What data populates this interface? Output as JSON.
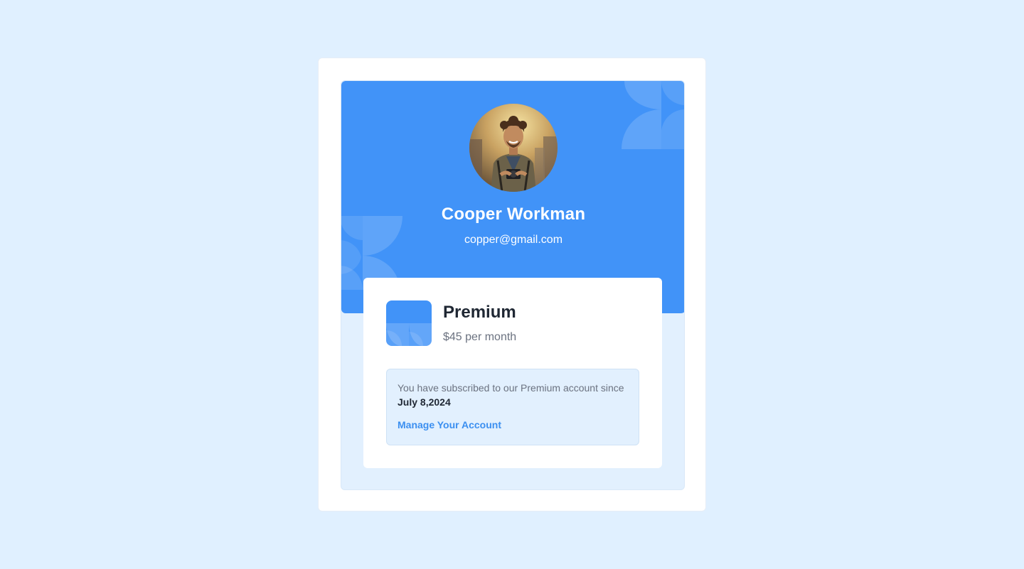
{
  "profile": {
    "name": "Cooper Workman",
    "email": "copper@gmail.com"
  },
  "plan": {
    "name": "Premium",
    "price": "$45 per month"
  },
  "subscription": {
    "message": "You have subscribed to our Premium account since",
    "date": "July 8,2024",
    "manage_label": "Manage Your Account"
  },
  "colors": {
    "background": "#e0f0ff",
    "hero": "#4193f8",
    "panel": "#e2f0fe",
    "link": "#3b8ff0",
    "heading": "#1f2733",
    "muted": "#6b7280"
  },
  "icons": {
    "avatar": "user-photo",
    "plan": "plan-badge-icon"
  }
}
